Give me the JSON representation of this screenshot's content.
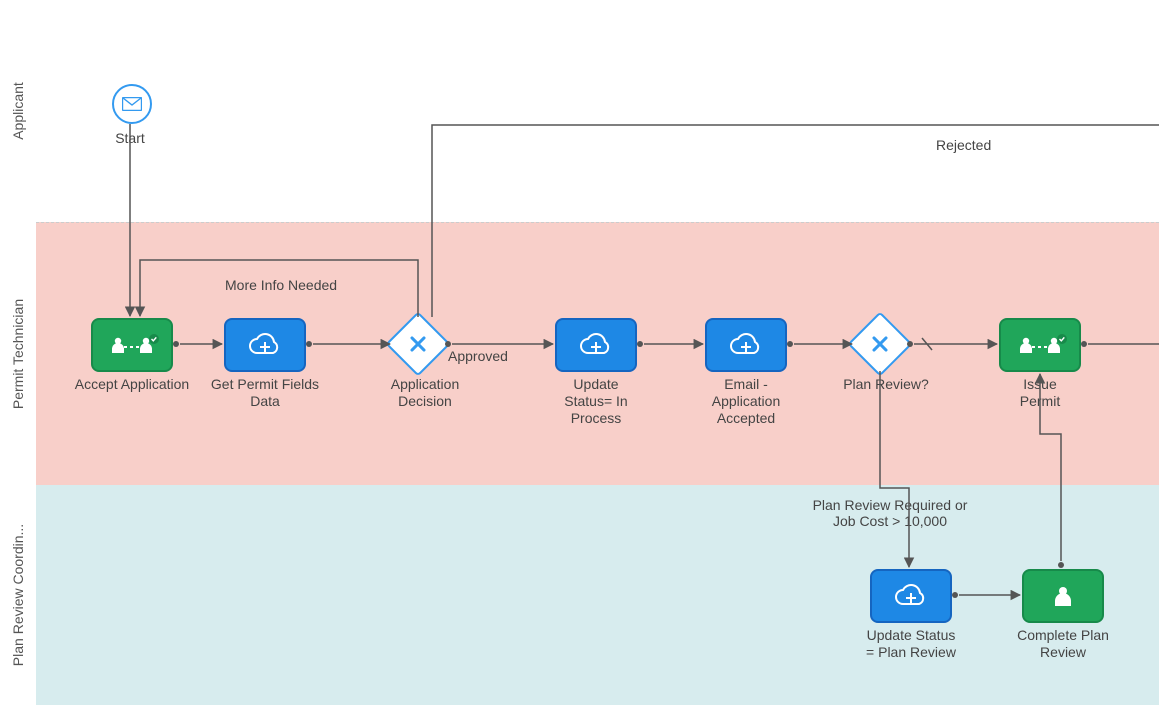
{
  "diagram": {
    "type": "BPMN process diagram",
    "lanes": [
      {
        "id": "applicant",
        "label": "Applicant"
      },
      {
        "id": "tech",
        "label": "Permit Technician"
      },
      {
        "id": "coord",
        "label": "Plan Review Coordin..."
      }
    ],
    "nodes": {
      "start": {
        "label": "Start",
        "kind": "message-start-event",
        "lane": "applicant"
      },
      "accept": {
        "label": "Accept Application",
        "kind": "user-task",
        "lane": "tech"
      },
      "getfields": {
        "label": "Get Permit Fields Data",
        "kind": "service-task",
        "lane": "tech"
      },
      "decision": {
        "label": "Application Decision",
        "kind": "exclusive-gateway",
        "lane": "tech"
      },
      "updInProcess": {
        "label": "Update Status= In Process",
        "kind": "service-task",
        "lane": "tech"
      },
      "emailAccepted": {
        "label": "Email - Application Accepted",
        "kind": "service-task",
        "lane": "tech"
      },
      "planReviewQ": {
        "label": "Plan Review?",
        "kind": "exclusive-gateway",
        "lane": "tech"
      },
      "issuePermit": {
        "label": "Issue Permit",
        "kind": "user-task",
        "lane": "tech"
      },
      "updPlanReview": {
        "label": "Update Status = Plan Review",
        "kind": "service-task",
        "lane": "coord"
      },
      "completePlanReview": {
        "label": "Complete Plan Review",
        "kind": "user-task",
        "lane": "coord"
      }
    },
    "edges": [
      {
        "from": "start",
        "to": "accept",
        "label": ""
      },
      {
        "from": "accept",
        "to": "getfields",
        "label": ""
      },
      {
        "from": "getfields",
        "to": "decision",
        "label": ""
      },
      {
        "from": "decision",
        "to": "accept",
        "label": "More Info Needed",
        "route": "up-back"
      },
      {
        "from": "decision",
        "to": "updInProcess",
        "label": "Approved"
      },
      {
        "from": "decision",
        "to": "(offscreen)",
        "label": "Rejected",
        "route": "up-right-offscreen"
      },
      {
        "from": "updInProcess",
        "to": "emailAccepted",
        "label": ""
      },
      {
        "from": "emailAccepted",
        "to": "planReviewQ",
        "label": ""
      },
      {
        "from": "planReviewQ",
        "to": "issuePermit",
        "label": "",
        "default": true
      },
      {
        "from": "planReviewQ",
        "to": "updPlanReview",
        "label": "Plan Review Required or Job Cost > 10,000"
      },
      {
        "from": "updPlanReview",
        "to": "completePlanReview",
        "label": ""
      },
      {
        "from": "completePlanReview",
        "to": "issuePermit",
        "label": ""
      }
    ],
    "edgeLabels": {
      "moreInfo": "More Info Needed",
      "approved": "Approved",
      "rejected": "Rejected",
      "planReq": "Plan Review Required or Job Cost > 10,000"
    }
  }
}
